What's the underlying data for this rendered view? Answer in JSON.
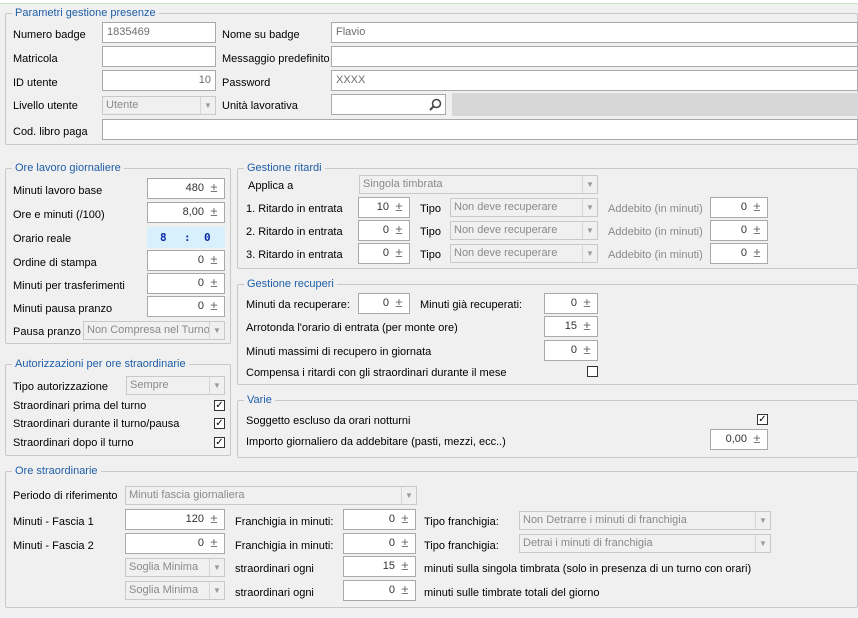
{
  "parametri": {
    "title": "Parametri gestione presenze",
    "numero_badge_label": "Numero badge",
    "numero_badge_value": "1835469",
    "matricola_label": "Matricola",
    "matricola_value": "",
    "id_utente_label": "ID utente",
    "id_utente_value": "10",
    "livello_utente_label": "Livello utente",
    "livello_utente_value": "Utente",
    "cod_libro_label": "Cod. libro paga",
    "cod_libro_value": "",
    "nome_badge_label": "Nome su badge",
    "nome_badge_value": "Flavio",
    "messaggio_label": "Messaggio predefinito",
    "messaggio_value": "",
    "password_label": "Password",
    "password_value": "XXXX",
    "unita_label": "Unità lavorativa",
    "unita_value": ""
  },
  "ore_lavoro": {
    "title": "Ore lavoro giornaliere",
    "minuti_base_label": "Minuti lavoro base",
    "minuti_base_value": "480",
    "ore_minuti_label": "Ore e minuti (/100)",
    "ore_minuti_value": "8,00",
    "orario_reale_label": "Orario reale",
    "orario_h": "8",
    "orario_sep": ":",
    "orario_m": "0",
    "ordine_label": "Ordine di stampa",
    "ordine_value": "0",
    "trasferimenti_label": "Minuti per trasferimenti",
    "trasferimenti_value": "0",
    "pausa_min_label": "Minuti pausa pranzo",
    "pausa_min_value": "0",
    "pausa_label": "Pausa pranzo",
    "pausa_value": "Non Compresa nel Turno"
  },
  "autorizzazioni": {
    "title": "Autorizzazioni per ore straordinarie",
    "tipo_label": "Tipo autorizzazione",
    "tipo_value": "Sempre",
    "prima_label": "Straordinari prima del turno",
    "prima_checked": "✓",
    "durante_label": "Straordinari durante il turno/pausa",
    "durante_checked": "✓",
    "dopo_label": "Straordinari dopo il turno",
    "dopo_checked": "✓"
  },
  "ritardi": {
    "title": "Gestione ritardi",
    "applica_label": "Applica a",
    "applica_value": "Singola timbrata",
    "tipo_label": "Tipo",
    "addebito_label": "Addebito (in minuti)",
    "rows": [
      {
        "label": "1. Ritardo in entrata",
        "value": "10",
        "tipo": "Non deve recuperare",
        "addebito": "0"
      },
      {
        "label": "2. Ritardo in entrata",
        "value": "0",
        "tipo": "Non deve recuperare",
        "addebito": "0"
      },
      {
        "label": "3. Ritardo in entrata",
        "value": "0",
        "tipo": "Non deve recuperare",
        "addebito": "0"
      }
    ]
  },
  "recuperi": {
    "title": "Gestione recuperi",
    "da_recuperare_label": "Minuti da recuperare:",
    "da_recuperare_value": "0",
    "recuperati_label": "Minuti già recuperati:",
    "recuperati_value": "0",
    "arrotonda_label": "Arrotonda l'orario di entrata (per monte ore)",
    "arrotonda_value": "15",
    "massimi_label": "Minuti massimi di recupero in giornata",
    "massimi_value": "0",
    "compensa_label": "Compensa i ritardi con gli straordinari durante il mese",
    "compensa_checked": ""
  },
  "varie": {
    "title": "Varie",
    "soggetto_label": "Soggetto escluso da orari notturni",
    "soggetto_checked": "✓",
    "importo_label": "Importo giornaliero da addebitare (pasti, mezzi, ecc..)",
    "importo_value": "0,00"
  },
  "straordinarie": {
    "title": "Ore straordinarie",
    "periodo_label": "Periodo di riferimento",
    "periodo_value": "Minuti fascia giornaliera",
    "fascia1_label": "Minuti - Fascia 1",
    "fascia1_value": "120",
    "fascia2_label": "Minuti - Fascia 2",
    "fascia2_value": "0",
    "franchigia_label": "Franchigia in minuti:",
    "franchigia1_value": "0",
    "franchigia2_value": "0",
    "tipo_fr_label": "Tipo franchigia:",
    "tipo_fr1_value": "Non Detrarre i minuti di franchigia",
    "tipo_fr2_value": "Detrai i minuti di franchigia",
    "soglia1_value": "Soglia Minima",
    "soglia2_value": "Soglia Minima",
    "ogni_label": "straordinari ogni",
    "ogni1_value": "15",
    "ogni2_value": "0",
    "singola_label": "minuti sulla singola timbrata (solo in presenza di un turno con orari)",
    "totali_label": "minuti sulle timbrate totali del giorno"
  },
  "icons": {
    "spin": "±",
    "dropdown": "▼",
    "search": "search-icon"
  }
}
